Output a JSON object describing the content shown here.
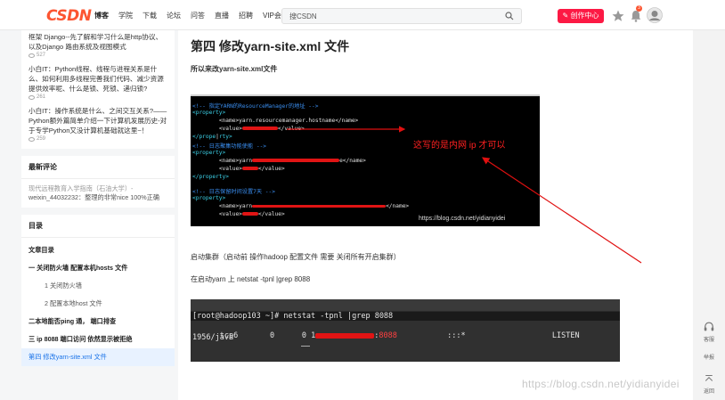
{
  "header": {
    "logo": "CSDN",
    "nav": [
      "博客",
      "学院",
      "下载",
      "论坛",
      "问答",
      "直播",
      "招聘",
      "VIP会员"
    ],
    "search_placeholder": "搜CSDN",
    "create_label": "创作中心",
    "notification_count": "3"
  },
  "sidebar": {
    "related": [
      {
        "title": "框架 Django--先了解和学习什么是http协议、以及Django 路由系统及视图模式",
        "views": "527"
      },
      {
        "title": "小白IT：Python线程、线程与进程关系是什么、如何利用多线程完善我们代码、减少资源提供效率呢、什么是锁、死锁、递归锁?",
        "views": "261"
      },
      {
        "title": "小白IT：操作系统是什么、之间交互关系?——Python额外篇简单介绍一下计算机发展历史-对于专学Python又没计算机基础就这里~！",
        "views": "259"
      }
    ],
    "comments_title": "最新评论",
    "comment_post": "现代远程教育入学指南（石油大学）-",
    "comment_text": "weixin_44032232：整理的非常nice 100%正确",
    "toc_title": "目录",
    "toc": [
      {
        "label": "文章目录",
        "level": "bold"
      },
      {
        "label": "一 关闭防火墙 配置本机hosts 文件",
        "level": "bold"
      },
      {
        "label": "1 关闭防火墙",
        "level": "sub"
      },
      {
        "label": "2 配置本地host 文件",
        "level": "sub"
      },
      {
        "label": "二本地能否ping 通， 端口排查",
        "level": "bold"
      },
      {
        "label": "三 ip 8088 端口访问 依然显示被拒绝",
        "level": "bold"
      },
      {
        "label": "第四 修改yarn-site.xml 文件",
        "level": "current"
      }
    ]
  },
  "article": {
    "heading": "第四 修改yarn-site.xml 文件",
    "intro": "所以来改yarn-site.xml文件",
    "code": {
      "comment1": "<!-- 指定YARN的ResourceManager的地址 -->",
      "prop_open": "<property>",
      "name1": "<name>yarn.resourcemanager.hostname</name>",
      "value1_open": "<value>",
      "value_close": "</value>",
      "prop_close_partial": "</prope",
      "prop_close_tail": "rty>",
      "comment2": "<!-- 日志聚集功能使能 -->",
      "name2_open": "<name>yarn",
      "name2_close": "e</name>",
      "value2_open": "<value>",
      "prop_close": "</property>",
      "comment3": "<!-- 日志保留时间设置7天 -->",
      "name3_open": "<name>yarn",
      "name3_tail": "</name>",
      "value3_open": "<value>",
      "annotation": "这写的是内网 ip 才可以",
      "watermark": "https://blog.csdn.net/yidianyidei"
    },
    "start_cluster": "启动集群（启动前 操作hadoop 配置文件 需要 关闭所有开启集群）",
    "check_port": "在启动yarn 上 netstat -tpnl |grep 8088",
    "terminal": {
      "prompt": "[root@hadoop103 ~]# netstat -tpnl |grep 8088",
      "proto": "tcp6",
      "recv": "0",
      "send": "0",
      "ip_prefix": "1",
      "port": "8088",
      "foreign": ":::*",
      "state": "LISTEN",
      "pid": "1956/java"
    },
    "watermark": "https://blog.csdn.net/yidianyidei"
  },
  "rail": {
    "service_label": "客服",
    "report_label": "举报",
    "top_label": "返回"
  },
  "colors": {
    "brand": "#fc5531",
    "create_btn": "#fc1944",
    "arrow": "#e01010"
  }
}
